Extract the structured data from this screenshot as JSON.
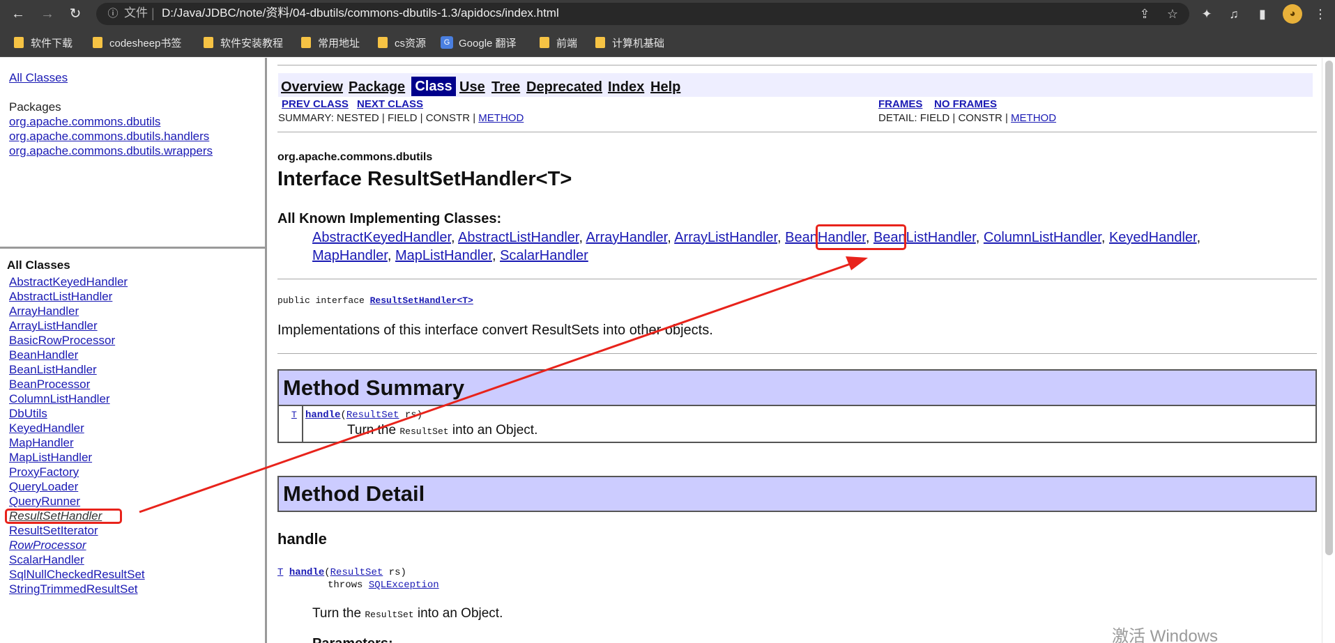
{
  "browser": {
    "file_label": "文件",
    "url": "D:/Java/JDBC/note/资料/04-dbutils/commons-dbutils-1.3/apidocs/index.html",
    "back_icon": "back-arrow-icon",
    "forward_icon": "forward-arrow-icon",
    "reload_icon": "reload-icon"
  },
  "bookmarks": [
    {
      "label": "软件下载",
      "icon": "folder-icon"
    },
    {
      "label": "codesheep书签",
      "icon": "folder-icon"
    },
    {
      "label": "软件安装教程",
      "icon": "folder-icon"
    },
    {
      "label": "常用地址",
      "icon": "folder-icon"
    },
    {
      "label": "cs资源",
      "icon": "folder-icon"
    },
    {
      "label": "Google 翻译",
      "icon": "google-translate-icon"
    },
    {
      "label": "前端",
      "icon": "folder-icon"
    },
    {
      "label": "计算机基础",
      "icon": "folder-icon"
    }
  ],
  "packages_frame": {
    "all_classes_link": "All Classes",
    "packages_title": "Packages",
    "packages": [
      "org.apache.commons.dbutils",
      "org.apache.commons.dbutils.handlers",
      "org.apache.commons.dbutils.wrappers"
    ]
  },
  "classes_frame": {
    "title": "All Classes",
    "classes": [
      "AbstractKeyedHandler",
      "AbstractListHandler",
      "ArrayHandler",
      "ArrayListHandler",
      "BasicRowProcessor",
      "BeanHandler",
      "BeanListHandler",
      "BeanProcessor",
      "ColumnListHandler",
      "DbUtils",
      "KeyedHandler",
      "MapHandler",
      "MapListHandler",
      "ProxyFactory",
      "QueryLoader",
      "QueryRunner",
      "ResultSetHandler",
      "ResultSetIterator",
      "RowProcessor",
      "ScalarHandler",
      "SqlNullCheckedResultSet",
      "StringTrimmedResultSet"
    ]
  },
  "nav": {
    "items": [
      "Overview",
      "Package",
      "Class",
      "Use",
      "Tree",
      "Deprecated",
      "Index",
      "Help"
    ],
    "prev_class": "PREV CLASS",
    "next_class": "NEXT CLASS",
    "frames": "FRAMES",
    "no_frames": "NO FRAMES",
    "summary_prefix": "SUMMARY: NESTED | FIELD | CONSTR | ",
    "detail_prefix": "DETAIL: FIELD | CONSTR | ",
    "method_link": "METHOD"
  },
  "doc": {
    "package_name": "org.apache.commons.dbutils",
    "interface_title": "Interface ResultSetHandler<T>",
    "known_title": "All Known Implementing Classes:",
    "implementing_classes_line1": [
      "AbstractKeyedHandler",
      "AbstractListHandler",
      "ArrayHandler",
      "ArrayListHandler",
      "BeanHandler",
      "BeanListHandler",
      "ColumnListHandler",
      "KeyedHandler"
    ],
    "implementing_classes_line2": [
      "MapHandler",
      "MapListHandler",
      "ScalarHandler"
    ],
    "decl_prefix": "public interface ",
    "decl_link": "ResultSetHandler<T>",
    "description": "Implementations of this interface convert ResultSets into other objects.",
    "method_summary_title": "Method Summary",
    "summary_type": "T",
    "summary_method": "handle",
    "summary_param_type": "ResultSet",
    "summary_param_name": " rs)",
    "summary_desc_a": "Turn the ",
    "summary_desc_code": "ResultSet",
    "summary_desc_b": " into an Object.",
    "method_detail_title": "Method Detail",
    "detail_method_heading": "handle",
    "detail_type": "T",
    "detail_method": "handle",
    "detail_param_type": "ResultSet",
    "detail_param_name": " rs)",
    "detail_throws": "throws ",
    "detail_exception": "SQLException",
    "detail_desc_a": "Turn the ",
    "detail_desc_code": "ResultSet",
    "detail_desc_b": " into an Object.",
    "params_partial": "Parameters:"
  },
  "watermark": "激活 Windows",
  "annotation_color": "#e8231b"
}
